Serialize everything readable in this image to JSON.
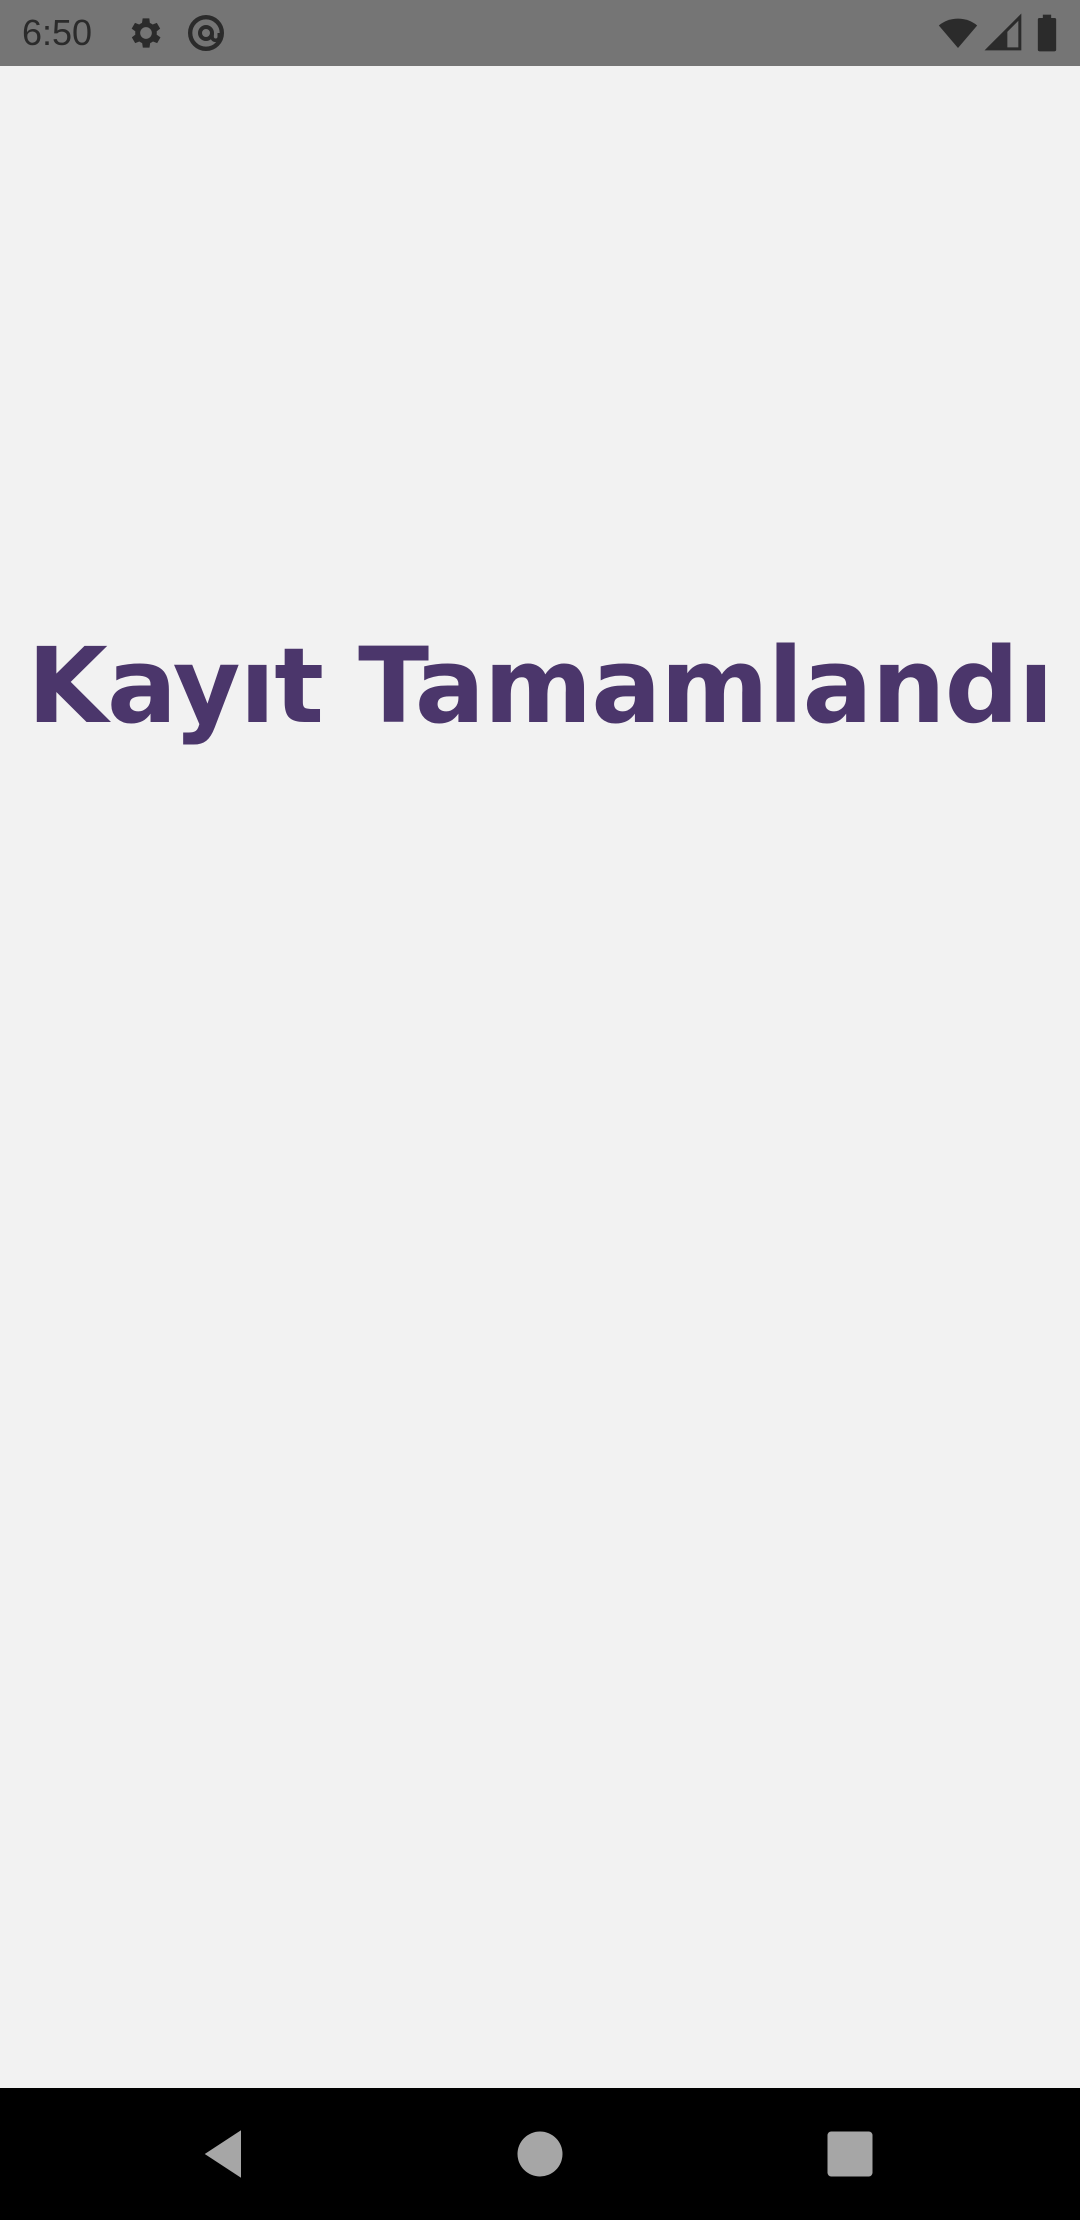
{
  "status_bar": {
    "time": "6:50",
    "icons": {
      "left": [
        "settings-gear-icon",
        "at-sign-icon"
      ],
      "right": [
        "wifi-icon",
        "cellular-signal-icon",
        "battery-icon"
      ]
    }
  },
  "main": {
    "title": "Kayıt Tamamlandı"
  },
  "nav_bar": {
    "buttons": [
      "back-triangle-icon",
      "home-circle-icon",
      "recents-square-icon"
    ]
  },
  "colors": {
    "background": "#f2f2f2",
    "status_bar": "#757575",
    "title": "#4b366b",
    "nav_bar": "#000000",
    "nav_icons": "#a6a6a6"
  }
}
